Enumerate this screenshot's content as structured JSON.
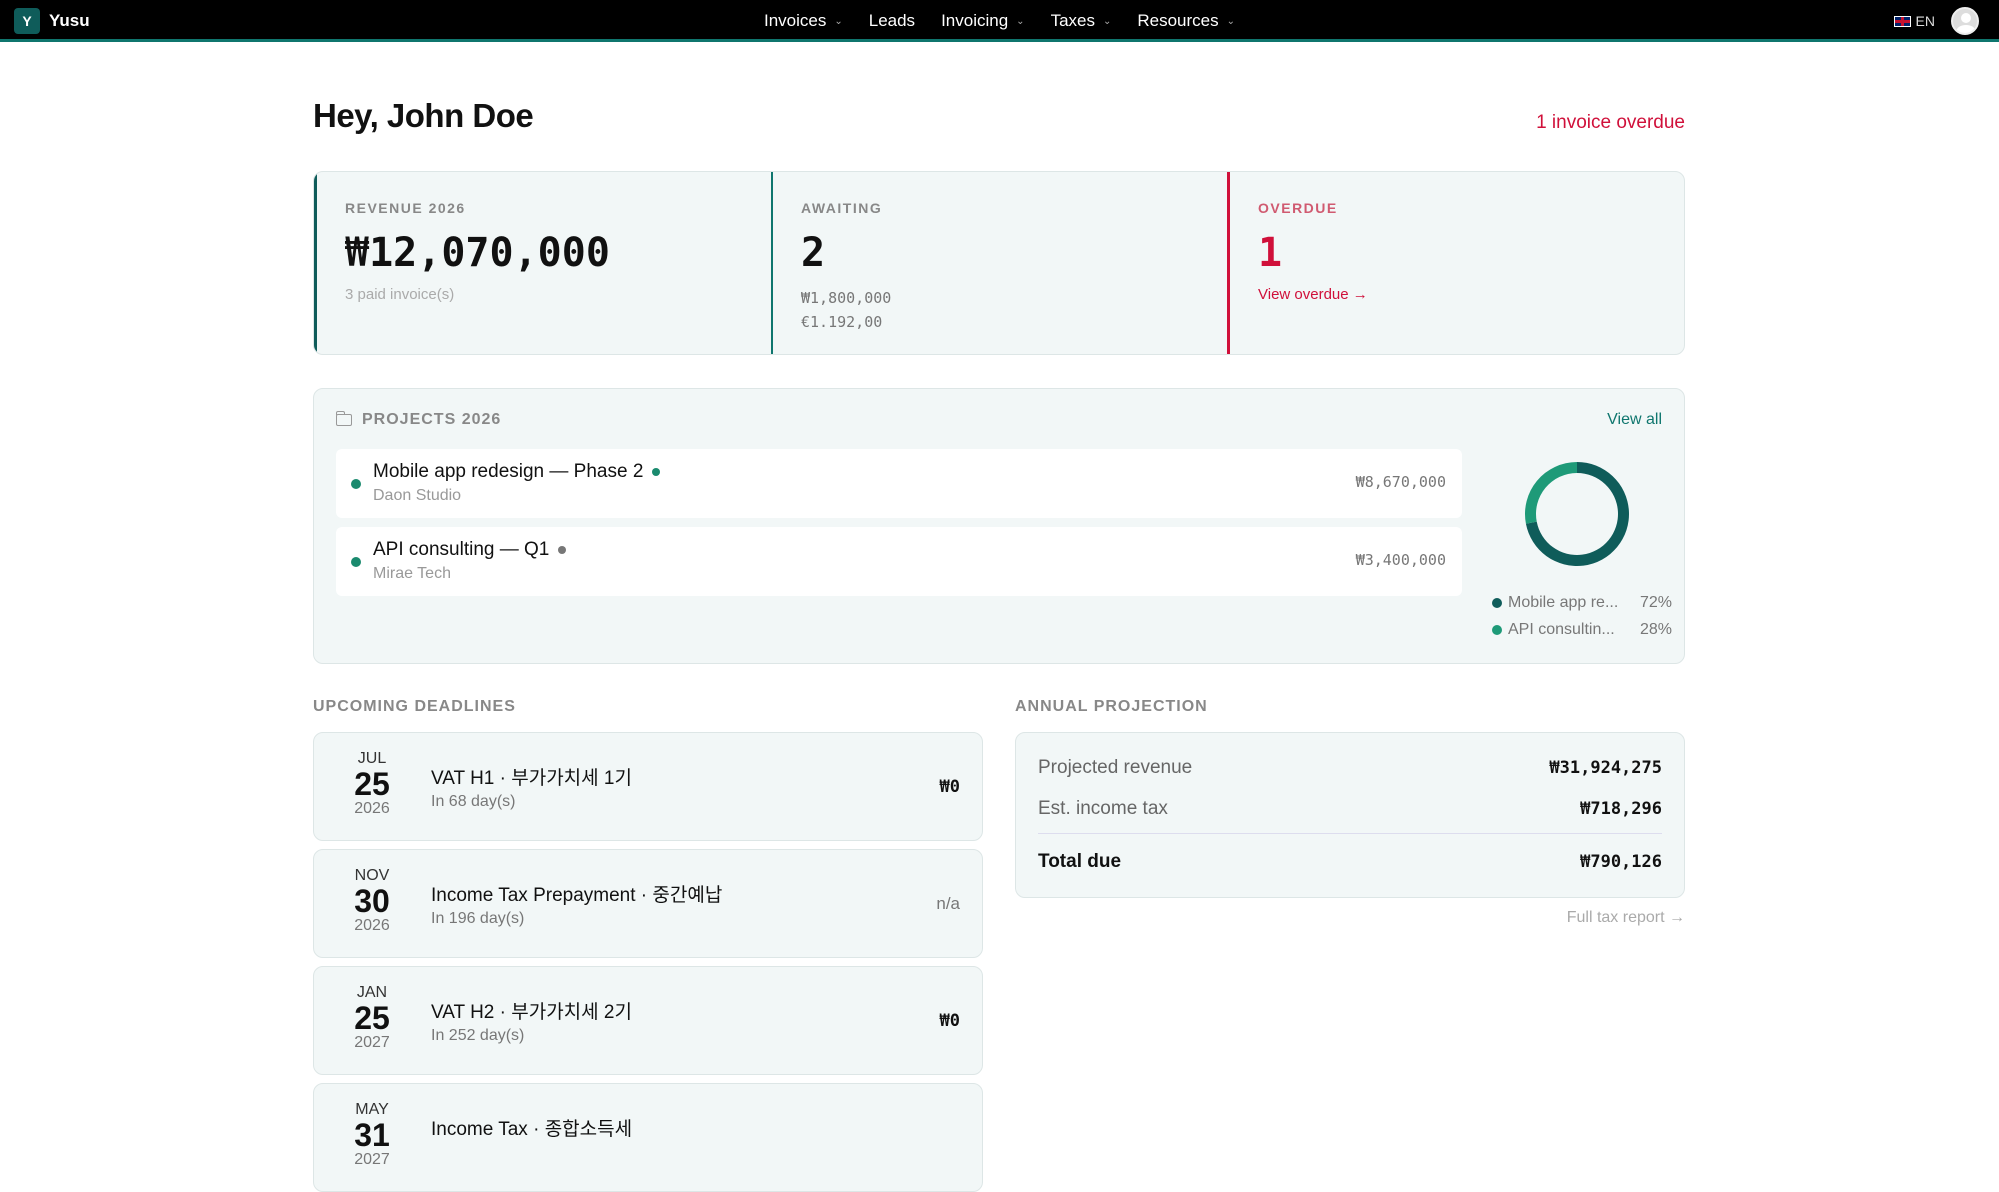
{
  "nav": {
    "brand_initial": "Y",
    "brand_name": "Yusu",
    "items": [
      {
        "label": "Invoices",
        "dropdown": true
      },
      {
        "label": "Leads",
        "dropdown": false
      },
      {
        "label": "Invoicing",
        "dropdown": true
      },
      {
        "label": "Taxes",
        "dropdown": true
      },
      {
        "label": "Resources",
        "dropdown": true
      }
    ],
    "language": "EN"
  },
  "header": {
    "greeting": "Hey, John Doe",
    "overdue_notice": "1 invoice overdue"
  },
  "stats": {
    "revenue": {
      "label": "REVENUE 2026",
      "value": "₩12,070,000",
      "sub": "3 paid invoice(s)"
    },
    "awaiting": {
      "label": "AWAITING",
      "value": "2",
      "amount_krw": "₩1,800,000",
      "amount_eur": "€1.192,00"
    },
    "overdue": {
      "label": "OVERDUE",
      "value": "1",
      "link": "View overdue →"
    }
  },
  "projects": {
    "title": "PROJECTS 2026",
    "view_all": "View all",
    "items": [
      {
        "name": "Mobile app redesign — Phase 2",
        "client": "Daon Studio",
        "amount": "₩8,670,000",
        "status_color": "#1a8a6e"
      },
      {
        "name": "API consulting — Q1",
        "client": "Mirae Tech",
        "amount": "₩3,400,000",
        "status_color": "#777777"
      }
    ],
    "legend": [
      {
        "label": "Mobile app re...",
        "percent": "72%",
        "share": 0.72,
        "color": "#0f5c5a"
      },
      {
        "label": "API consultin...",
        "percent": "28%",
        "share": 0.28,
        "color": "#1e9a78"
      }
    ]
  },
  "deadlines": {
    "title": "UPCOMING DEADLINES",
    "items": [
      {
        "month": "JUL",
        "day": "25",
        "year": "2026",
        "title": "VAT H1 · 부가가치세 1기",
        "sub": "In 68 day(s)",
        "amount": "₩0"
      },
      {
        "month": "NOV",
        "day": "30",
        "year": "2026",
        "title": "Income Tax Prepayment · 중간예납",
        "sub": "In 196 day(s)",
        "amount": "n/a"
      },
      {
        "month": "JAN",
        "day": "25",
        "year": "2027",
        "title": "VAT H2 · 부가가치세 2기",
        "sub": "In 252 day(s)",
        "amount": "₩0"
      },
      {
        "month": "MAY",
        "day": "31",
        "year": "2027",
        "title": "Income Tax · 종합소득세",
        "sub": "",
        "amount": ""
      }
    ]
  },
  "projection": {
    "title": "ANNUAL PROJECTION",
    "projected_label": "Projected revenue",
    "projected_value": "₩31,924,275",
    "tax_label": "Est. income tax",
    "tax_value": "₩718,296",
    "total_label": "Total due",
    "total_value": "₩790,126",
    "report_link": "Full tax report →"
  },
  "colors": {
    "accent": "#0f766e",
    "danger": "#d0103a"
  }
}
